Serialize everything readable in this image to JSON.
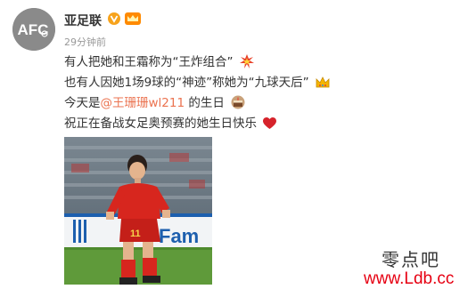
{
  "account": {
    "name": "亚足联",
    "timestamp": "29分钟前",
    "avatar_logo": "AFC"
  },
  "post": {
    "line1": "有人把她和王霜称为“王炸组合”",
    "line2": "也有人因她1场9球的“神迹”称她为“九球天后”",
    "line3_prefix": "今天是",
    "line3_mention": "@王珊珊wl211",
    "line3_suffix": " 的生日",
    "line4": "祝正在备战女足奥预赛的她生日快乐"
  },
  "photo": {
    "jersey_number": "11",
    "banner_text": "Fam"
  },
  "watermark": {
    "chinese": "零点吧",
    "url": "www.Ldb.cc"
  },
  "colors": {
    "mention": "#eb7350",
    "jersey_red": "#d7261e",
    "watermark_url": "#e60012"
  }
}
